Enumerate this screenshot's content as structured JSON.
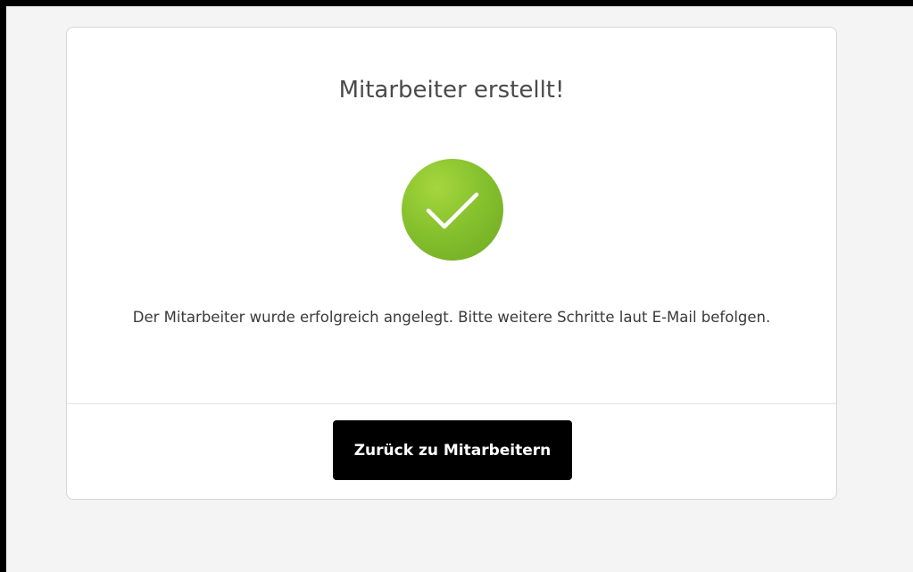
{
  "dialog": {
    "title": "Mitarbeiter erstellt!",
    "success_icon": "checkmark-circle-icon",
    "message": "Der Mitarbeiter wurde erfolgreich angelegt. Bitte weitere Schritte laut E-Mail befolgen.",
    "back_button_label": "Zurück zu Mitarbeitern"
  },
  "colors": {
    "success_green": "#86c22e",
    "button_bg": "#000000",
    "button_text": "#ffffff",
    "page_bg": "#f4f4f4",
    "card_bg": "#ffffff"
  }
}
